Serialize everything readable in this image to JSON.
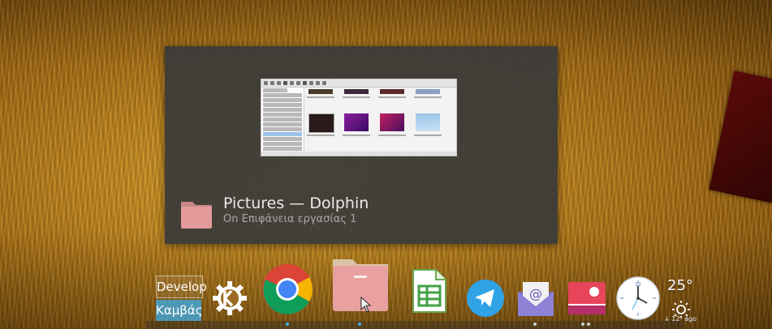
{
  "window_switcher": {
    "title": "Pictures — Dolphin",
    "subtitle": "Οn Επιφάνεια εργασίας 1"
  },
  "pager": {
    "desktops": [
      "Develop",
      "Καμβάς"
    ],
    "active": 1
  },
  "dock": {
    "items": [
      {
        "name": "kde",
        "icon": "kde-gear-icon"
      },
      {
        "name": "chrome",
        "icon": "chrome-icon"
      },
      {
        "name": "dolphin",
        "icon": "folder-icon",
        "active": true
      },
      {
        "name": "libreoffice-calc",
        "icon": "spreadsheet-icon"
      },
      {
        "name": "telegram",
        "icon": "paper-plane-icon"
      },
      {
        "name": "mail",
        "icon": "mail-icon"
      },
      {
        "name": "photos",
        "icon": "photo-icon"
      },
      {
        "name": "clock",
        "icon": "clock-icon"
      }
    ]
  },
  "weather": {
    "temperature": "25°",
    "icon": "sun-icon",
    "note": "↓ 12ʰ ago"
  },
  "colors": {
    "folder": "#e39a9a",
    "chrome_red": "#db4437",
    "chrome_yellow": "#f4b400",
    "chrome_green": "#0f9d58",
    "chrome_blue": "#4285f4",
    "telegram": "#2fa3e6",
    "indicator": "#3daee9"
  }
}
